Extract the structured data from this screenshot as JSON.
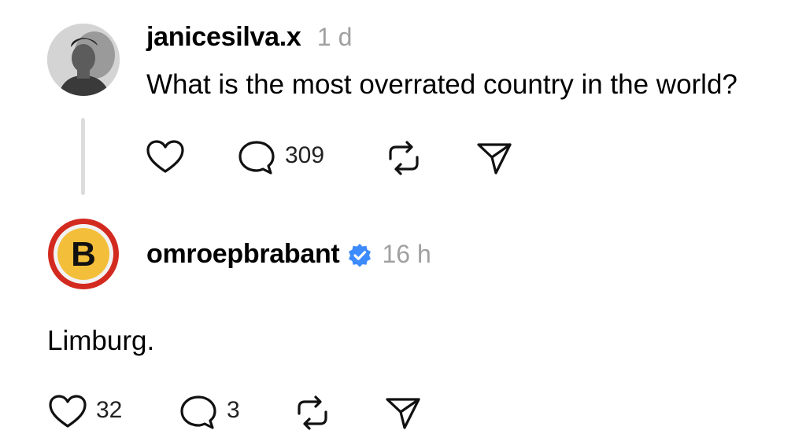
{
  "post": {
    "username": "janicesilva.x",
    "time": "1 d",
    "text": "What is the most overrated country in the world?",
    "actions": {
      "like_count": "",
      "reply_count": "309"
    },
    "icons": [
      "heart-icon",
      "comment-icon",
      "repost-icon",
      "share-icon"
    ]
  },
  "reply": {
    "username": "omroepbrabant",
    "verified": true,
    "time": "16 h",
    "text": "Limburg.",
    "avatar_letter": "B",
    "actions": {
      "like_count": "32",
      "reply_count": "3"
    },
    "icons": [
      "heart-icon",
      "comment-icon",
      "repost-icon",
      "share-icon"
    ]
  },
  "colors": {
    "verified_blue": "#3d8bfd",
    "time_gray": "#a0a0a0",
    "logo_red": "#d32a1f",
    "logo_yellow": "#f3be3a"
  }
}
